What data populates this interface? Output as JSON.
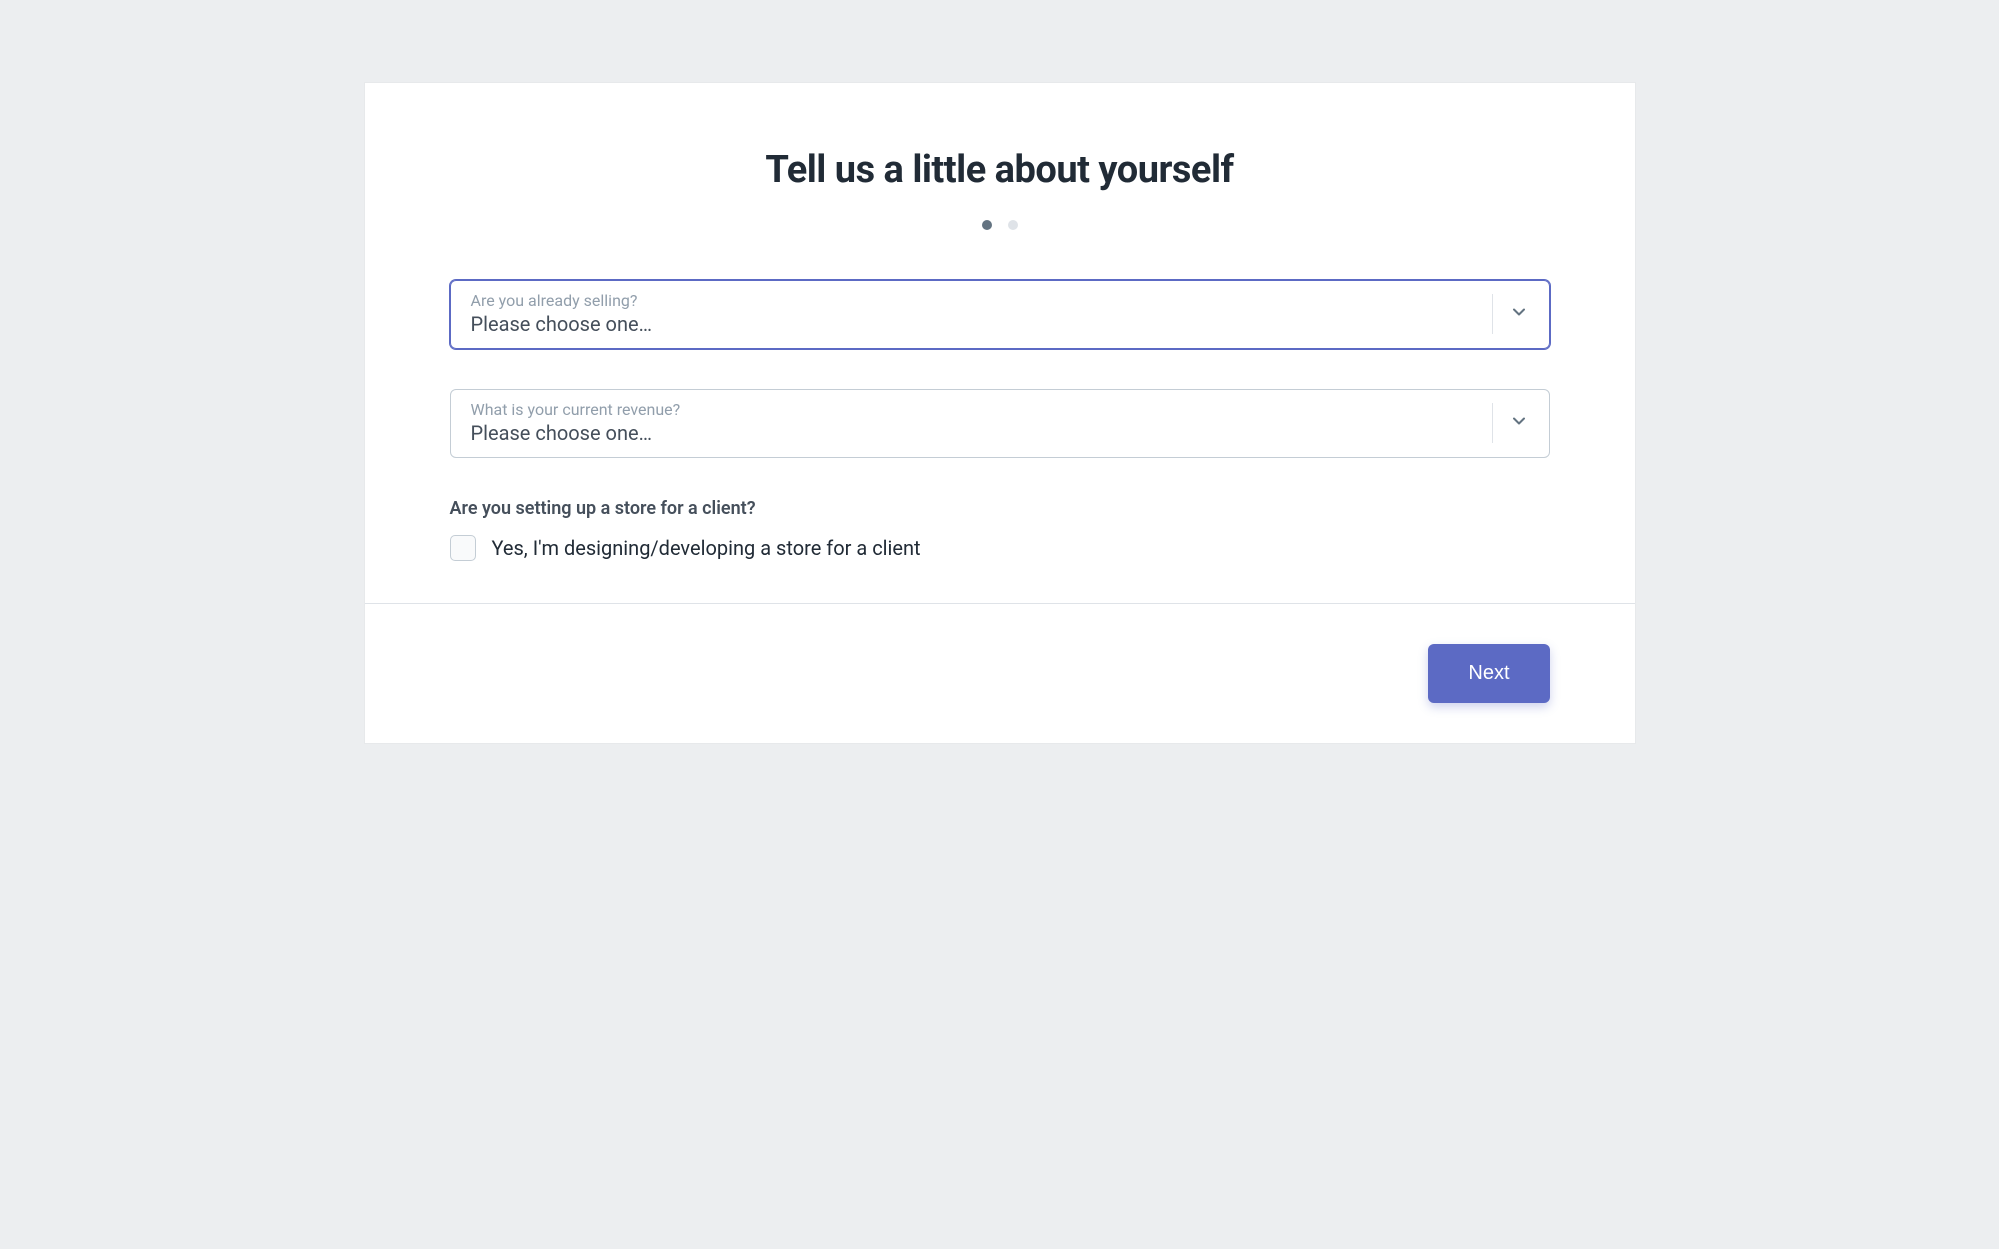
{
  "header": {
    "title": "Tell us a little about yourself"
  },
  "progress": {
    "current_step": 1,
    "total_steps": 2
  },
  "form": {
    "selling": {
      "label": "Are you already selling?",
      "value": "Please choose one…"
    },
    "revenue": {
      "label": "What is your current revenue?",
      "value": "Please choose one…"
    },
    "client_setup": {
      "question": "Are you setting up a store for a client?",
      "checkbox_label": "Yes, I'm designing/developing a store for a client",
      "checked": false
    }
  },
  "footer": {
    "next_label": "Next"
  },
  "colors": {
    "accent": "#5c6ac4",
    "text_dark": "#212b36",
    "text_muted": "#919eab",
    "border": "#c4cdd5",
    "background": "#eceef0"
  }
}
